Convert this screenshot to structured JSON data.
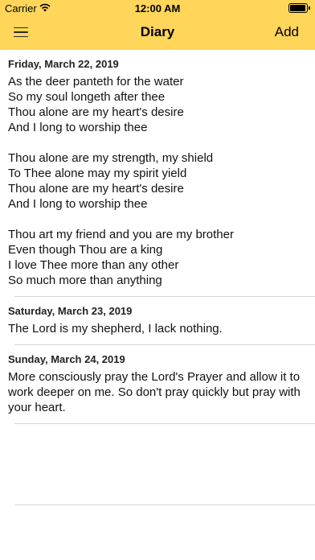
{
  "status_bar": {
    "carrier": "Carrier",
    "time": "12:00 AM"
  },
  "nav": {
    "title": "Diary",
    "add_label": "Add"
  },
  "entries": [
    {
      "date": "Friday, March 22, 2019",
      "text": "As the deer panteth for the water\nSo my soul longeth after thee\nThou alone are my heart's desire\nAnd I long to worship thee\n\nThou alone are my strength, my shield\nTo Thee alone may my spirit yield\nThou alone are my heart's desire\nAnd I long to worship thee\n\nThou art my friend and you are my brother\nEven though Thou are a king\nI love Thee more than any other\nSo much more than anything"
    },
    {
      "date": "Saturday, March 23, 2019",
      "text": "The Lord is my shepherd, I lack nothing."
    },
    {
      "date": "Sunday, March 24, 2019",
      "text": "More consciously pray the Lord's Prayer and allow it to work deeper on me. So don't pray quickly but pray with your heart."
    }
  ]
}
